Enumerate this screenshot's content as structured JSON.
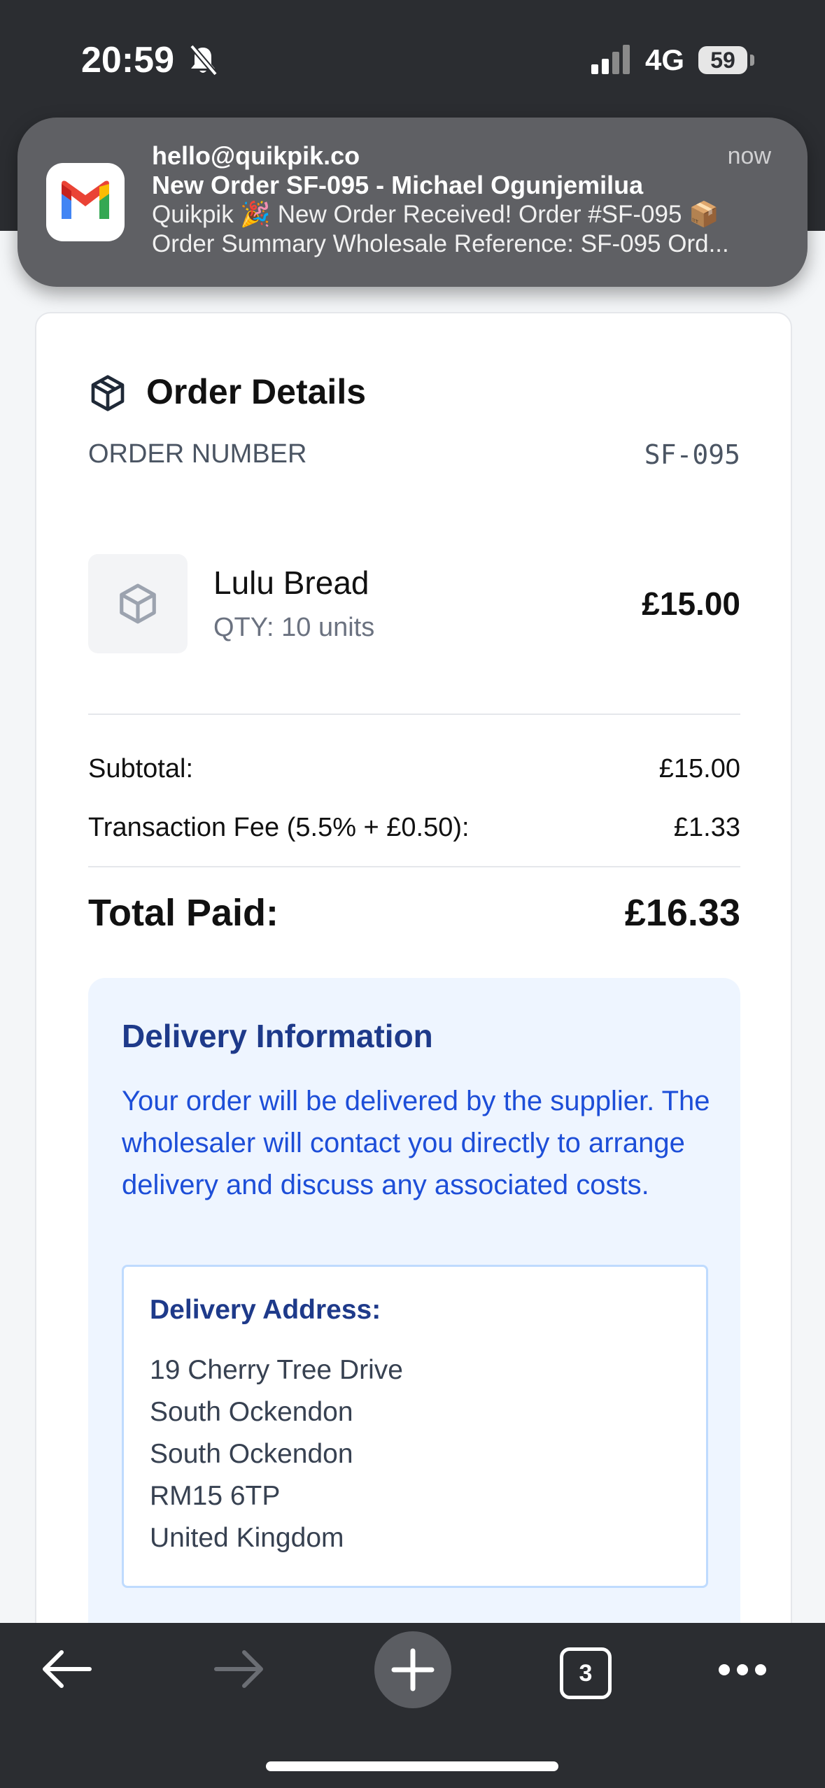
{
  "status_bar": {
    "time": "20:59",
    "network": "4G",
    "battery": "59"
  },
  "notification": {
    "sender": "hello@quikpik.co",
    "time": "now",
    "subject": "New Order SF-095 - Michael Ogunjemilua",
    "body_line1": "Quikpik 🎉 New Order Received! Order #SF-095 📦",
    "body_line2": "Order Summary Wholesale Reference: SF-095 Ord..."
  },
  "order": {
    "section_title": "Order Details",
    "order_number_label": "ORDER NUMBER",
    "order_number": "SF-095",
    "item": {
      "name": "Lulu Bread",
      "qty": "QTY: 10 units",
      "price": "£15.00"
    },
    "subtotal_label": "Subtotal:",
    "subtotal": "£15.00",
    "fee_label": "Transaction Fee (5.5% + £0.50):",
    "fee": "£1.33",
    "total_label": "Total Paid:",
    "total": "£16.33"
  },
  "delivery": {
    "title": "Delivery Information",
    "text": "Your order will be delivered by the supplier. The wholesaler will contact you directly to arrange delivery and discuss any associated costs.",
    "address_title": "Delivery Address:",
    "address_lines": [
      "19 Cherry Tree Drive",
      "South Ockendon",
      "South Ockendon",
      "RM15 6TP",
      "United Kingdom"
    ]
  },
  "toolbar": {
    "tab_count": "3"
  },
  "icons": {
    "bell": "bell-slash-icon",
    "signal": "signal-icon",
    "app": "gmail-icon",
    "order": "package-icon",
    "back": "back-arrow-icon",
    "forward": "forward-arrow-icon",
    "new_tab": "plus-icon",
    "tabs": "tabs-icon",
    "menu": "more-icon"
  },
  "colors": {
    "accent_blue": "#1d4ed8",
    "delivery_bg": "#eef5ff",
    "dark_bar": "#2b2d31"
  }
}
